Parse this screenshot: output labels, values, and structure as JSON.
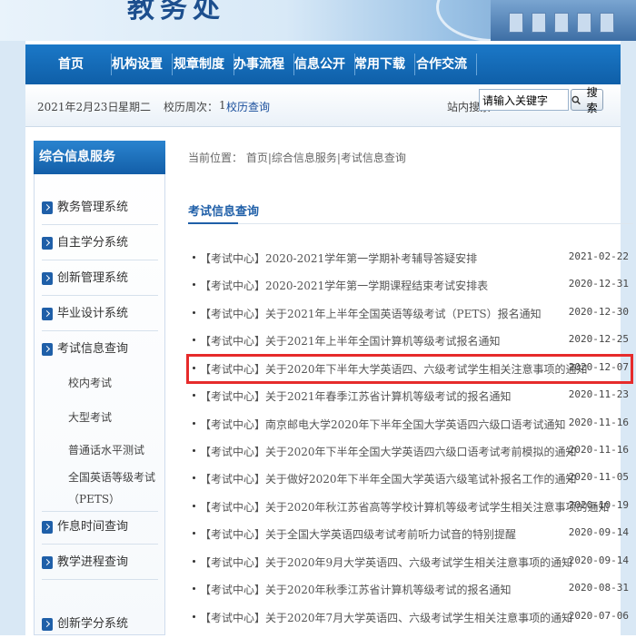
{
  "header": {
    "logo_text": "教务处"
  },
  "nav": {
    "items": [
      "首页",
      "机构设置",
      "规章制度",
      "办事流程",
      "信息公开",
      "常用下载",
      "合作交流"
    ]
  },
  "subbar": {
    "date": "2021年2月23日",
    "weekday": "星期二",
    "week_label": "校历周次：",
    "week_value": "1",
    "calendar_link": "校历查询",
    "search_label": "站内搜索",
    "search_value": "请输入关键字",
    "search_button": "搜索"
  },
  "sidebar": {
    "title": "综合信息服务",
    "items": [
      {
        "label": "教务管理系统"
      },
      {
        "label": "自主学分系统"
      },
      {
        "label": "创新管理系统"
      },
      {
        "label": "毕业设计系统"
      },
      {
        "label": "考试信息查询"
      },
      {
        "label": "作息时间查询"
      },
      {
        "label": "教学进程查询"
      },
      {
        "label": "创新学分系统"
      }
    ],
    "subitems": [
      "校内考试",
      "大型考试",
      "普通话水平测试",
      "全国英语等级考试",
      "（PETS）"
    ]
  },
  "breadcrumb": "当前位置： 首页|综合信息服务|考试信息查询",
  "section_title": "考试信息查询",
  "news": [
    {
      "title": "【考试中心】2020-2021学年第一学期补考辅导答疑安排",
      "date": "2021-02-22"
    },
    {
      "title": "【考试中心】2020-2021学年第一学期课程结束考试安排表",
      "date": "2020-12-31"
    },
    {
      "title": "【考试中心】关于2021年上半年全国英语等级考试（PETS）报名通知",
      "date": "2020-12-30"
    },
    {
      "title": "【考试中心】关于2021年上半年全国计算机等级考试报名通知",
      "date": "2020-12-25"
    },
    {
      "title": "【考试中心】关于2020年下半年大学英语四、六级考试学生相关注意事项的通知",
      "date": "2020-12-07"
    },
    {
      "title": "【考试中心】关于2021年春季江苏省计算机等级考试的报名通知",
      "date": "2020-11-23"
    },
    {
      "title": "【考试中心】南京邮电大学2020年下半年全国大学英语四六级口语考试通知",
      "date": "2020-11-16"
    },
    {
      "title": "【考试中心】关于2020年下半年全国大学英语四六级口语考试考前模拟的通知",
      "date": "2020-11-16"
    },
    {
      "title": "【考试中心】关于做好2020年下半年全国大学英语六级笔试补报名工作的通知",
      "date": "2020-11-05"
    },
    {
      "title": "【考试中心】关于2020年秋江苏省高等学校计算机等级考试学生相关注意事项的通知",
      "date": "2020-10-19"
    },
    {
      "title": "【考试中心】关于全国大学英语四级考试考前听力试音的特别提醒",
      "date": "2020-09-14"
    },
    {
      "title": "【考试中心】关于2020年9月大学英语四、六级考试学生相关注意事项的通知",
      "date": "2020-09-14"
    },
    {
      "title": "【考试中心】关于2020年秋季江苏省计算机等级考试的报名通知",
      "date": "2020-08-31"
    },
    {
      "title": "【考试中心】关于2020年7月大学英语四、六级考试学生相关注意事项的通知",
      "date": "2020-07-06"
    }
  ],
  "colors": {
    "nav": "#0f5fa8",
    "accent": "#1f5fa8",
    "highlight": "#e62b2b"
  }
}
